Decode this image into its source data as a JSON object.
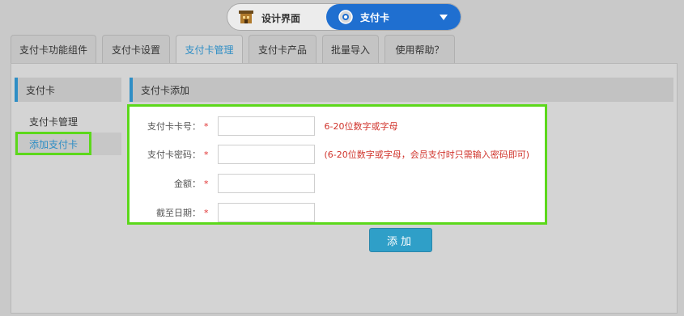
{
  "switcher": {
    "design_label": "设计界面",
    "design_icon": "building-icon",
    "current_label": "支付卡",
    "current_icon": "gear-icon",
    "accent": "#1f6fd0"
  },
  "tabs": [
    {
      "label": "支付卡功能组件",
      "active": false
    },
    {
      "label": "支付卡设置",
      "active": false
    },
    {
      "label": "支付卡管理",
      "active": true
    },
    {
      "label": "支付卡产品",
      "active": false
    },
    {
      "label": "批量导入",
      "active": false
    },
    {
      "label": "使用帮助？",
      "active": false
    }
  ],
  "sidebar": {
    "title": "支付卡",
    "items": [
      {
        "label": "支付卡管理"
      },
      {
        "label": "添加支付卡"
      }
    ]
  },
  "main": {
    "title": "支付卡添加",
    "fields": [
      {
        "label": "支付卡卡号：",
        "required": "*",
        "value": "",
        "hint": "6-20位数字或字母"
      },
      {
        "label": "支付卡密码：",
        "required": "*",
        "value": "",
        "hint": "(6-20位数字或字母，会员支付时只需输入密码即可)"
      },
      {
        "label": "金额：",
        "required": "*",
        "value": "",
        "hint": ""
      },
      {
        "label": "截至日期：",
        "required": "*",
        "value": "",
        "hint": ""
      }
    ],
    "submit_label": "添加"
  },
  "colors": {
    "highlight": "#5cd81b",
    "link": "#2f8ec5",
    "required": "#e03030",
    "button": "#2f9fc8"
  }
}
